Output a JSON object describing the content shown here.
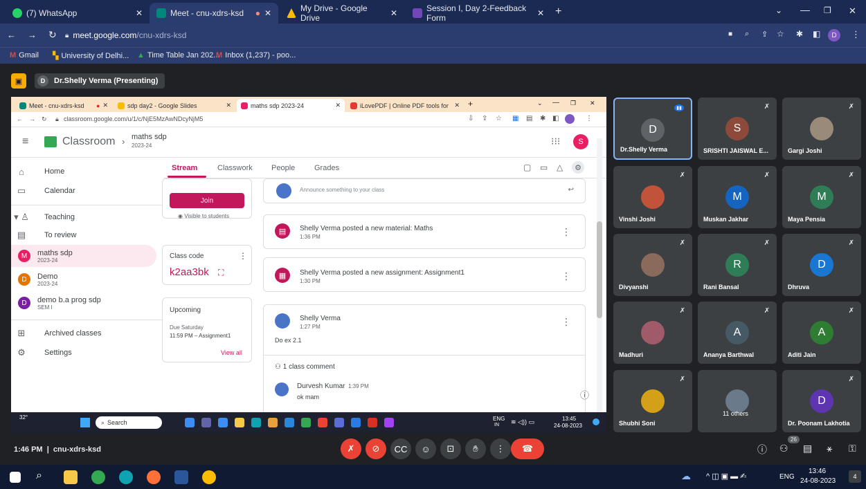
{
  "browser": {
    "tabs": [
      {
        "label": "(7) WhatsApp",
        "color": "#25D366"
      },
      {
        "label": "Meet - cnu-xdrs-ksd",
        "color": "#00897B"
      },
      {
        "label": "My Drive - Google Drive",
        "color": "#FBBC04"
      },
      {
        "label": "Session I, Day 2-Feedback Form",
        "color": "#7248B9"
      }
    ],
    "url_host": "meet.google.com",
    "url_path": "/cnu-xdrs-ksd",
    "bookmarks": [
      "Gmail",
      "University of Delhi...",
      "Time Table Jan 202...",
      "Inbox (1,237) - poo..."
    ],
    "profile_initial": "D"
  },
  "meet": {
    "presenter_label": "Dr.Shelly Verma (Presenting)",
    "presenter_initial": "D",
    "time": "1:46 PM",
    "code": "cnu-xdrs-ksd",
    "people_count": "26",
    "participants": [
      {
        "name": "Dr.Shelly Verma",
        "initial": "D",
        "color": "#5f6368",
        "active": true
      },
      {
        "name": "SRISHTI JAISWAL E...",
        "initial": "S",
        "color": "#8d4a3a"
      },
      {
        "name": "Gargi Joshi",
        "initial": "",
        "color": "#9a8a7a"
      },
      {
        "name": "Vinshi Joshi",
        "initial": "",
        "color": "#c0533a"
      },
      {
        "name": "Muskan Jakhar",
        "initial": "M",
        "color": "#1565c0"
      },
      {
        "name": "Maya Pensia",
        "initial": "M",
        "color": "#2e7d57"
      },
      {
        "name": "Divyanshi",
        "initial": "",
        "color": "#8a6a5a"
      },
      {
        "name": "Rani Bansal",
        "initial": "R",
        "color": "#2e7d57"
      },
      {
        "name": "Dhruva",
        "initial": "D",
        "color": "#1976d2"
      },
      {
        "name": "Madhuri",
        "initial": "",
        "color": "#a05a6a"
      },
      {
        "name": "Ananya Barthwal",
        "initial": "A",
        "color": "#455a64"
      },
      {
        "name": "Aditi Jain",
        "initial": "A",
        "color": "#2e7d32"
      },
      {
        "name": "Shubhi Soni",
        "initial": "",
        "color": "#d4a017"
      },
      {
        "name": "11 others",
        "initial": "",
        "color": "#6a7a8a"
      },
      {
        "name": "Dr. Poonam Lakhotia",
        "initial": "D",
        "color": "#5e35b1"
      }
    ]
  },
  "share": {
    "tabs": [
      "Meet - cnu-xdrs-ksd",
      "sdp day2 - Google Slides",
      "maths sdp 2023-24",
      "iLovePDF | Online PDF tools for"
    ],
    "url": "classroom.google.com/u/1/c/NjE5MzAwNDcyNjM5",
    "app_name": "Classroom",
    "class_name": "maths sdp",
    "class_year": "2023-24",
    "user_initial": "S",
    "sidebar": {
      "home": "Home",
      "calendar": "Calendar",
      "teaching": "Teaching",
      "to_review": "To review",
      "classes": [
        {
          "name": "maths sdp",
          "sub": "2023-24",
          "initial": "M",
          "color": "#e91e63"
        },
        {
          "name": "Demo",
          "sub": "2023-24",
          "initial": "D",
          "color": "#e37400"
        },
        {
          "name": "demo b.a prog sdp",
          "sub": "SEM I",
          "initial": "D",
          "color": "#7b1fa2"
        }
      ],
      "archived": "Archived classes",
      "settings": "Settings"
    },
    "tabs_nav": [
      "Stream",
      "Classwork",
      "People",
      "Grades"
    ],
    "join_label": "Join",
    "visible_label": "Visible to students",
    "class_code_label": "Class code",
    "class_code": "k2aa3bk",
    "upcoming_label": "Upcoming",
    "upcoming_due": "Due Saturday",
    "upcoming_item": "11:59 PM – Assignment1",
    "view_all": "View all",
    "announce_placeholder": "Announce something to your class",
    "posts": [
      {
        "title": "Shelly Verma posted a new material: Maths",
        "time": "1:36 PM"
      },
      {
        "title": "Shelly Verma posted a new assignment: Assignment1",
        "time": "1:30 PM"
      }
    ],
    "announcement": {
      "author": "Shelly Verma",
      "time": "1:27 PM",
      "body": "Do ex 2.1",
      "comments": "1 class comment",
      "commenter": "Durvesh Kumar",
      "comment_time": "1:39 PM",
      "comment": "ok mam"
    },
    "task": {
      "temp": "32°",
      "search": "Search",
      "lang": "ENG",
      "region": "IN",
      "time": "13:45",
      "date": "24-08-2023"
    }
  },
  "windows": {
    "lang": "ENG",
    "time": "13:46",
    "date": "24-08-2023",
    "notif": "4"
  }
}
